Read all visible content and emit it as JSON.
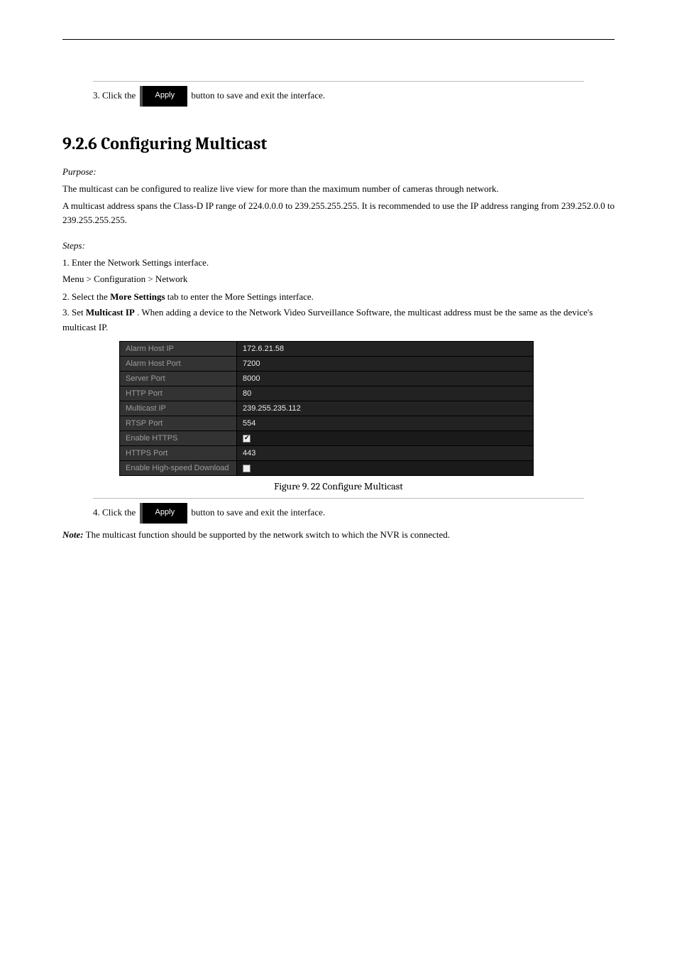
{
  "page": {
    "step3_prefix": "3.",
    "step3_text_a": "Click the ",
    "apply_label": "Apply",
    "step3_text_b": " button to save and exit the interface.",
    "heading": "9.2.6 Configuring Multicast",
    "purpose_label": "Purpose:",
    "purpose_body": "The multicast can be configured to realize live view for more than the maximum number of cameras through network.",
    "body2": "A multicast address spans the Class-D IP range of 224.0.0.0 to 239.255.255.255. It is recommended to use the IP address ranging from 239.252.0.0 to 239.255.255.255.",
    "steps_label": "Steps:",
    "step1": "1.",
    "step1_text": "Enter the Network Settings interface.",
    "step1_path": "Menu > Configuration > Network",
    "step2": "2.",
    "step2_text": "Select the ",
    "step2_bold": "More Settings",
    "step2_tail": " tab to enter the More Settings interface.",
    "step3b": "3.",
    "step3b_text": "Set ",
    "step3b_bold": "Multicast IP",
    "step3b_body": ". When adding a device to the Network Video Surveillance Software, the multicast address must be the same as the device's multicast IP.",
    "fig_caption": "Figure 9. 22  Configure Multicast",
    "step4": "4.",
    "step4_text_a": "Click the ",
    "step4_text_b": " button to save and exit the interface.",
    "note_label": "Note:",
    "note_body": " The multicast function should be supported by the network switch to which the NVR is connected."
  },
  "config_rows": [
    {
      "label": "Alarm Host IP",
      "value": "172.6.21.58"
    },
    {
      "label": "Alarm Host Port",
      "value": "7200"
    },
    {
      "label": "Server Port",
      "value": "8000"
    },
    {
      "label": "HTTP Port",
      "value": "80"
    },
    {
      "label": "Multicast IP",
      "value": "239.255.235.112"
    },
    {
      "label": "RTSP Port",
      "value": "554"
    },
    {
      "label": "Enable HTTPS",
      "value": "__checkbox_checked"
    },
    {
      "label": "HTTPS Port",
      "value": "443"
    },
    {
      "label": "Enable High-speed Download",
      "value": "__checkbox_unchecked"
    }
  ]
}
